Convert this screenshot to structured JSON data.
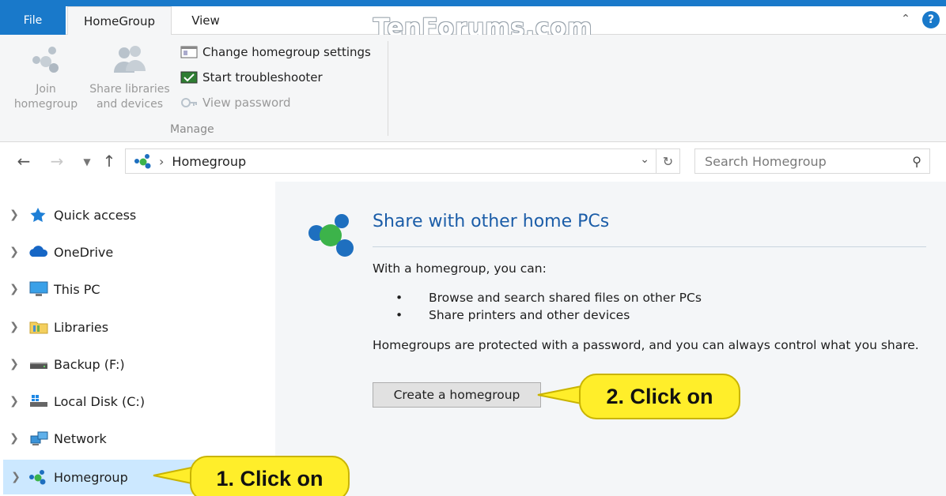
{
  "ribbon_tabs": {
    "file": "File",
    "homegroup": "HomeGroup",
    "view": "View"
  },
  "watermark": "TenForums.com",
  "help": "?",
  "ribbon": {
    "join_line1": "Join",
    "join_line2": "homegroup",
    "share_line1": "Share libraries",
    "share_line2": "and devices",
    "change_settings": "Change homegroup settings",
    "start_troubleshooter": "Start troubleshooter",
    "view_password": "View password",
    "group_label": "Manage"
  },
  "address": {
    "breadcrumb_sep": "›",
    "location": "Homegroup",
    "search_placeholder": "Search Homegroup"
  },
  "nav": {
    "items": [
      {
        "label": "Quick access"
      },
      {
        "label": "OneDrive"
      },
      {
        "label": "This PC"
      },
      {
        "label": "Libraries"
      },
      {
        "label": "Backup (F:)"
      },
      {
        "label": "Local Disk (C:)"
      },
      {
        "label": "Network"
      },
      {
        "label": "Homegroup"
      }
    ]
  },
  "content": {
    "title": "Share with other home PCs",
    "intro": "With a homegroup, you can:",
    "bullets": [
      "Browse and search shared files on other PCs",
      "Share printers and other devices"
    ],
    "note": "Homegroups are protected with a password, and you can always control what you share.",
    "create_button": "Create a homegroup"
  },
  "callouts": {
    "one": "1. Click on",
    "two": "2. Click on"
  },
  "colors": {
    "accent": "#1979ca",
    "title": "#1b5da8",
    "callout": "#ffee2a",
    "selection": "#cce8ff"
  }
}
